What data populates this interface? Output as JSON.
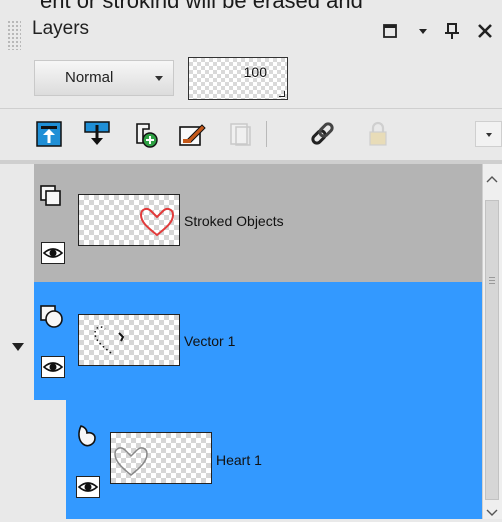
{
  "panel": {
    "top_fragment": "ent or stroking will be erased and",
    "title": "Layers"
  },
  "titlebar_icons": [
    "maximize-icon",
    "dropdown-icon",
    "pin-icon",
    "close-icon"
  ],
  "blend_mode": {
    "value": "Normal"
  },
  "opacity": {
    "value": "100"
  },
  "toolbar": {
    "icons": [
      "move-layer-up-icon",
      "move-layer-down-icon",
      "add-vector-icon",
      "edit-layer-icon",
      "group-icon",
      "link-icon",
      "lock-icon"
    ],
    "colors": {
      "blue": "#1f8fd6",
      "orange": "#c65a1b",
      "disabled": "#c9c9c9"
    }
  },
  "layers": [
    {
      "name": "Stroked Objects",
      "selected": false,
      "bg": "#b4b4b4",
      "visible": true,
      "type_icon": "group-layer-icon"
    },
    {
      "name": "Vector 1",
      "selected": true,
      "bg": "#3399ff",
      "visible": true,
      "type_icon": "vector-layer-icon"
    },
    {
      "name": "Heart 1",
      "selected": true,
      "bg": "#3399ff",
      "visible": true,
      "type_icon": "shape-object-icon"
    }
  ],
  "colors": {
    "panel_bg": "#e9e9e9",
    "selected_bg": "#3399ff",
    "group_bg": "#b4b4b4",
    "heart_red": "#e23a3a"
  }
}
